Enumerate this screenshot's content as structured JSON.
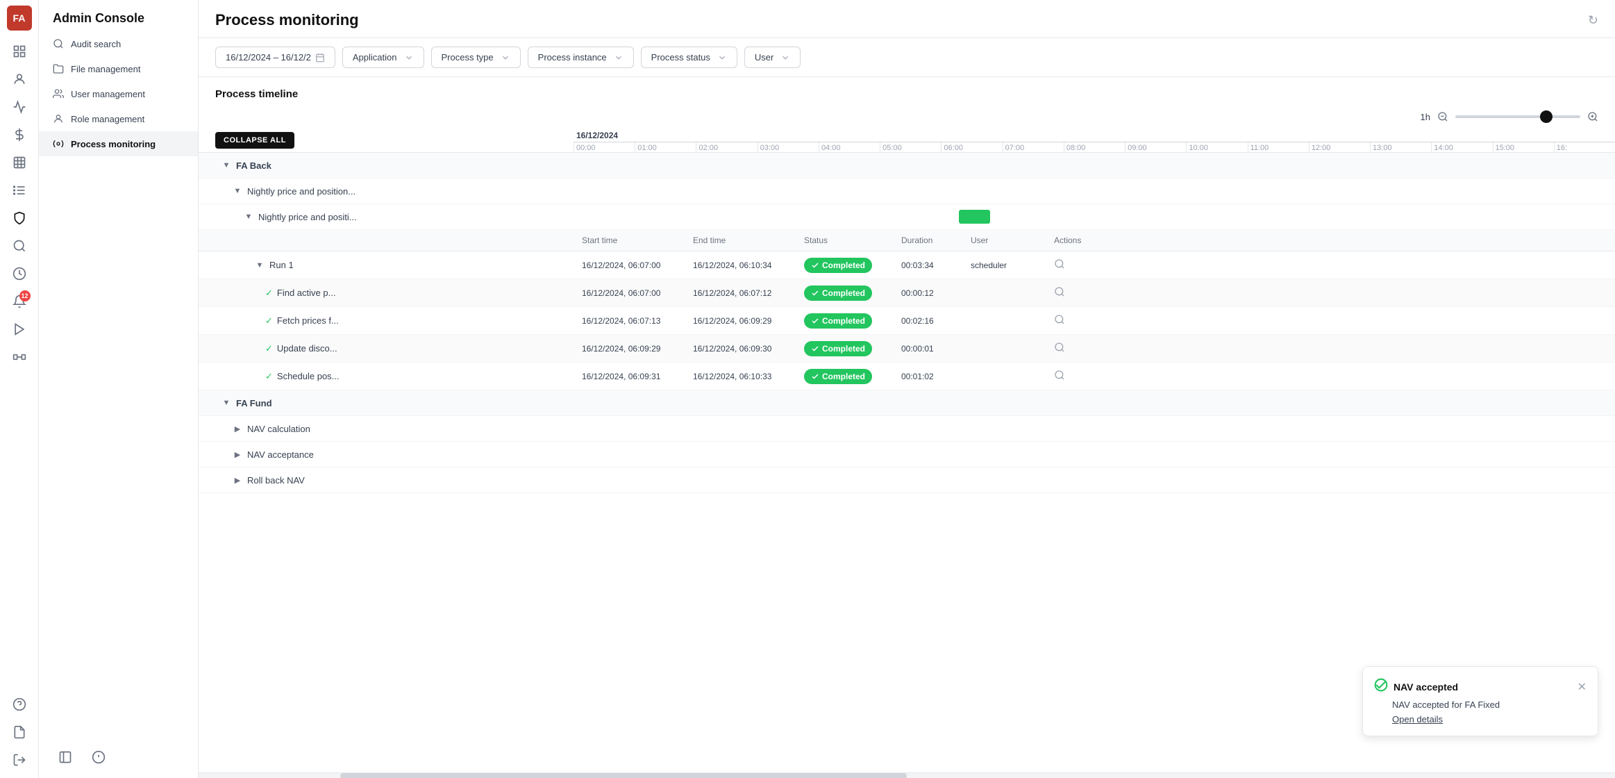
{
  "app": {
    "logo": "FA",
    "title": "Admin Console"
  },
  "sidebar": {
    "icons": [
      {
        "name": "home-icon",
        "symbol": "⊞",
        "active": false
      },
      {
        "name": "users-icon",
        "symbol": "👤",
        "active": false
      },
      {
        "name": "chart-icon",
        "symbol": "📊",
        "active": false
      },
      {
        "name": "dollar-icon",
        "symbol": "💲",
        "active": false
      },
      {
        "name": "grid-icon",
        "symbol": "⊟",
        "active": false
      },
      {
        "name": "list-icon",
        "symbol": "☰",
        "active": false
      },
      {
        "name": "shield-icon",
        "symbol": "🛡",
        "active": false
      },
      {
        "name": "search-icon",
        "symbol": "🔍",
        "active": false
      },
      {
        "name": "clock-icon",
        "symbol": "🕐",
        "active": false
      },
      {
        "name": "bell-icon",
        "symbol": "🔔",
        "active": true,
        "badge": "12"
      },
      {
        "name": "play-icon",
        "symbol": "▶",
        "active": false
      },
      {
        "name": "connector-icon",
        "symbol": "⇄",
        "active": false
      },
      {
        "name": "help-icon",
        "symbol": "?",
        "active": false
      },
      {
        "name": "document-icon",
        "symbol": "📄",
        "active": false
      }
    ],
    "bottom_icons": [
      {
        "name": "collapse-icon",
        "symbol": "❮"
      },
      {
        "name": "info-icon",
        "symbol": "ℹ"
      },
      {
        "name": "logout-icon",
        "symbol": "→"
      }
    ]
  },
  "nav": {
    "title": "Admin Console",
    "items": [
      {
        "id": "audit-search",
        "label": "Audit search",
        "icon": "search"
      },
      {
        "id": "file-management",
        "label": "File management",
        "icon": "file"
      },
      {
        "id": "user-management",
        "label": "User management",
        "icon": "users"
      },
      {
        "id": "role-management",
        "label": "Role management",
        "icon": "role"
      },
      {
        "id": "process-monitoring",
        "label": "Process monitoring",
        "icon": "process",
        "active": true
      }
    ]
  },
  "page": {
    "title": "Process monitoring",
    "refresh_icon": "↻"
  },
  "filters": {
    "date_range": "16/12/2024 – 16/12/2",
    "date_icon": "📅",
    "application_label": "Application",
    "process_type_label": "Process type",
    "process_instance_label": "Process instance",
    "process_status_label": "Process status",
    "user_label": "User"
  },
  "timeline": {
    "section_title": "Process timeline",
    "collapse_all": "COLLAPSE ALL",
    "zoom_label": "1h",
    "date_label": "16/12/2024",
    "ticks": [
      "00:00",
      "01:00",
      "02:00",
      "03:00",
      "04:00",
      "05:00",
      "06:00",
      "07:00",
      "08:00",
      "09:00",
      "10:00",
      "11:00",
      "12:00",
      "13:00",
      "14:00",
      "15:00",
      "16:"
    ],
    "table_headers": {
      "start_time": "Start time",
      "end_time": "End time",
      "status": "Status",
      "duration": "Duration",
      "user": "User",
      "actions": "Actions"
    },
    "groups": [
      {
        "name": "FA Back",
        "expanded": true,
        "children": [
          {
            "name": "Nightly price and position...",
            "expanded": true,
            "children": [
              {
                "name": "Nightly price and positi...",
                "expanded": true,
                "has_bar": true,
                "bar_offset_pct": 37.5,
                "bar_width_pct": 3,
                "children": [
                  {
                    "name": "Run 1",
                    "expanded": true,
                    "start_time": "16/12/2024, 06:07:00",
                    "end_time": "16/12/2024, 06:10:34",
                    "status": "Completed",
                    "duration": "00:03:34",
                    "user": "scheduler",
                    "children": [
                      {
                        "name": "Find active p...",
                        "start_time": "16/12/2024, 06:07:00",
                        "end_time": "16/12/2024, 06:07:12",
                        "status": "Completed",
                        "duration": "00:00:12",
                        "user": ""
                      },
                      {
                        "name": "Fetch prices f...",
                        "start_time": "16/12/2024, 06:07:13",
                        "end_time": "16/12/2024, 06:09:29",
                        "status": "Completed",
                        "duration": "00:02:16",
                        "user": ""
                      },
                      {
                        "name": "Update disco...",
                        "start_time": "16/12/2024, 06:09:29",
                        "end_time": "16/12/2024, 06:09:30",
                        "status": "Completed",
                        "duration": "00:00:01",
                        "user": ""
                      },
                      {
                        "name": "Schedule pos...",
                        "start_time": "16/12/2024, 06:09:31",
                        "end_time": "16/12/2024, 06:10:33",
                        "status": "Completed",
                        "duration": "00:01:02",
                        "user": ""
                      }
                    ]
                  }
                ]
              }
            ]
          }
        ]
      },
      {
        "name": "FA Fund",
        "expanded": true,
        "children": [
          {
            "name": "NAV calculation",
            "expanded": false
          },
          {
            "name": "NAV acceptance",
            "expanded": false
          },
          {
            "name": "Roll back NAV",
            "expanded": false
          }
        ]
      }
    ]
  },
  "notification": {
    "title": "NAV accepted",
    "body": "NAV accepted for FA Fixed",
    "link": "Open details",
    "icon": "✓"
  }
}
